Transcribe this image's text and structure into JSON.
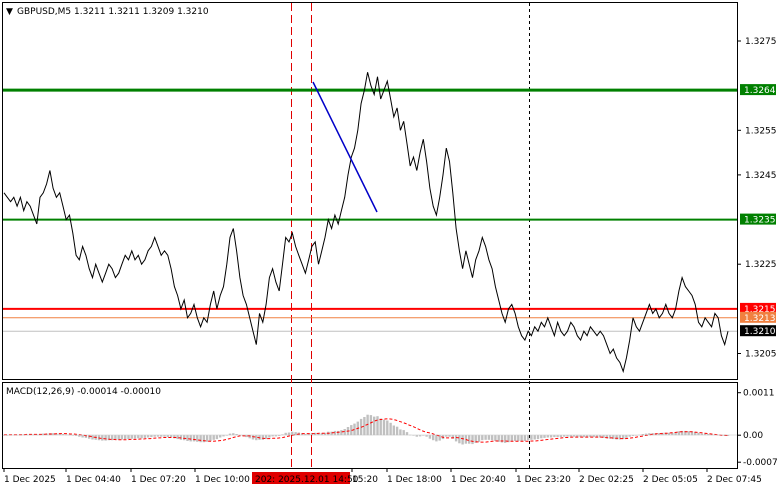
{
  "header": {
    "symbol_line": "GBPUSD,M5  1.3211 1.3211 1.3209 1.3210"
  },
  "price_axis": {
    "ticks": [
      "1.3275",
      "1.3255",
      "1.3245",
      "1.3225",
      "1.3205"
    ],
    "tick_values": [
      1.3275,
      1.3255,
      1.3245,
      1.3225,
      1.3205
    ],
    "range": [
      1.31993,
      1.32835
    ]
  },
  "levels": [
    {
      "name": "upper-green",
      "price": 1.3264,
      "label": "1.3264",
      "color": "#008000"
    },
    {
      "name": "middle-green",
      "price": 1.3235,
      "label": "1.3235",
      "color": "#008000"
    },
    {
      "name": "red",
      "price": 1.3215,
      "label": "1.3215",
      "color": "#ff0000"
    },
    {
      "name": "orange",
      "price": 1.3213,
      "label": "1.3213",
      "color": "#f08040"
    },
    {
      "name": "current",
      "price": 1.321,
      "label": "1.3210",
      "color": "#c0c0c0"
    }
  ],
  "macd": {
    "header": "MACD(12,26,9) -0.00014 -0.00010",
    "ticks": [
      "0.0011",
      "0.00",
      "-0.0007"
    ],
    "tick_values": [
      0.0011,
      0.0,
      -0.0007
    ],
    "range": [
      -0.00085,
      0.00135
    ],
    "histogram_color": "#c0c0c0",
    "signal_color": "#ff0000"
  },
  "time_axis": {
    "labels": [
      "1 Dec 2025",
      "1 Dec 04:40",
      "1 Dec 07:20",
      "1 Dec 10:00",
      "15:20",
      "1 Dec 18:00",
      "1 Dec 20:40",
      "1 Dec 23:20",
      "2 Dec 02:25",
      "2 Dec 05:05",
      "2 Dec 07:45"
    ],
    "highlight_label": "202: 2025.12.01 14:50",
    "highlight_color": "#e00000"
  },
  "colors": {
    "price_line": "#000000",
    "trend_line": "#0000c8",
    "red_dashed": "#e00000",
    "black_dotted": "#000000"
  },
  "chart_data": {
    "type": "line",
    "series": [
      {
        "values": [
          1.3241,
          1.324,
          1.3239,
          1.324,
          1.3238,
          1.324,
          1.3237,
          1.3239,
          1.3238,
          1.3236,
          1.3234,
          1.324,
          1.3241,
          1.3243,
          1.3246,
          1.3242,
          1.324,
          1.3241,
          1.3238,
          1.3235,
          1.3236,
          1.3232,
          1.3227,
          1.3226,
          1.3229,
          1.3227,
          1.3224,
          1.3222,
          1.3225,
          1.3223,
          1.3221,
          1.3223,
          1.3225,
          1.3224,
          1.3222,
          1.3223,
          1.3225,
          1.3227,
          1.3226,
          1.3228,
          1.3226,
          1.3227,
          1.3225,
          1.3226,
          1.3228,
          1.3229,
          1.3231,
          1.3229,
          1.3227,
          1.3228,
          1.3227,
          1.3224,
          1.322,
          1.3218,
          1.3215,
          1.3217,
          1.3213,
          1.3214,
          1.3216,
          1.3213,
          1.3211,
          1.3213,
          1.3212,
          1.3216,
          1.3219,
          1.3215,
          1.3218,
          1.322,
          1.3225,
          1.3231,
          1.3233,
          1.3228,
          1.3222,
          1.3218,
          1.3216,
          1.3213,
          1.321,
          1.3207,
          1.3214,
          1.3212,
          1.3216,
          1.3222,
          1.3224,
          1.3221,
          1.3219,
          1.3225,
          1.3231,
          1.323,
          1.3232,
          1.3229,
          1.3227,
          1.3225,
          1.3223,
          1.3226,
          1.3229,
          1.323,
          1.3225,
          1.3228,
          1.3231,
          1.3235,
          1.3233,
          1.3236,
          1.3234,
          1.3237,
          1.324,
          1.3245,
          1.3249,
          1.3251,
          1.3255,
          1.3261,
          1.3264,
          1.3268,
          1.3265,
          1.3263,
          1.3267,
          1.3262,
          1.3264,
          1.3266,
          1.3262,
          1.3258,
          1.326,
          1.3255,
          1.3257,
          1.3252,
          1.3247,
          1.3249,
          1.3246,
          1.325,
          1.3253,
          1.3248,
          1.3242,
          1.3238,
          1.3236,
          1.324,
          1.3245,
          1.3251,
          1.3248,
          1.3241,
          1.3233,
          1.3228,
          1.3224,
          1.3228,
          1.3225,
          1.3222,
          1.3226,
          1.3228,
          1.3231,
          1.3229,
          1.3226,
          1.3224,
          1.322,
          1.3217,
          1.3214,
          1.3212,
          1.3215,
          1.3216,
          1.3214,
          1.3211,
          1.3209,
          1.3208,
          1.321,
          1.3209,
          1.3211,
          1.321,
          1.3212,
          1.3211,
          1.3213,
          1.3211,
          1.3209,
          1.3212,
          1.321,
          1.3209,
          1.321,
          1.3212,
          1.3211,
          1.3209,
          1.3208,
          1.321,
          1.3209,
          1.3211,
          1.321,
          1.3209,
          1.321,
          1.3209,
          1.3207,
          1.3205,
          1.3206,
          1.3204,
          1.3203,
          1.3201,
          1.3204,
          1.3208,
          1.3213,
          1.3211,
          1.321,
          1.3212,
          1.3214,
          1.3216,
          1.3214,
          1.3215,
          1.3213,
          1.3214,
          1.3216,
          1.3214,
          1.3213,
          1.3215,
          1.3219,
          1.3222,
          1.322,
          1.3219,
          1.3218,
          1.3216,
          1.3212,
          1.3211,
          1.3213,
          1.3212,
          1.3211,
          1.3214,
          1.3213,
          1.3209,
          1.3207,
          1.321
        ]
      }
    ],
    "macd_histogram": [
      0.0,
      0.0,
      1e-05,
      1e-05,
      1e-05,
      2e-05,
      2e-05,
      2e-05,
      2e-05,
      2e-05,
      2e-05,
      3e-05,
      4e-05,
      4e-05,
      5e-05,
      5e-05,
      4e-05,
      4e-05,
      3e-05,
      2e-05,
      1e-05,
      0.0,
      -2e-05,
      -4e-05,
      -6e-05,
      -7e-05,
      -9e-05,
      -0.00011,
      -0.00012,
      -0.00013,
      -0.00014,
      -0.00014,
      -0.00013,
      -0.00013,
      -0.00012,
      -0.00012,
      -0.00011,
      -0.0001,
      -0.0001,
      -9e-05,
      -9e-05,
      -8e-05,
      -8e-05,
      -7e-05,
      -6e-05,
      -5e-05,
      -4e-05,
      -4e-05,
      -4e-05,
      -4e-05,
      -5e-05,
      -6e-05,
      -8e-05,
      -0.0001,
      -0.00012,
      -0.00013,
      -0.00015,
      -0.00016,
      -0.00016,
      -0.00017,
      -0.00018,
      -0.00018,
      -0.00017,
      -0.00015,
      -0.00012,
      -0.0001,
      -6e-05,
      -3e-05,
      0.0,
      4e-05,
      5e-05,
      3e-05,
      0.0,
      -2e-05,
      -5e-05,
      -8e-05,
      -0.00011,
      -0.00013,
      -0.00012,
      -0.00012,
      -0.0001,
      -6e-05,
      -3e-05,
      -3e-05,
      -2e-05,
      2e-05,
      6e-05,
      7e-05,
      9e-05,
      8e-05,
      7e-05,
      5e-05,
      3e-05,
      4e-05,
      5e-05,
      6e-05,
      4e-05,
      5e-05,
      6e-05,
      9e-05,
      9e-05,
      0.00011,
      0.00011,
      0.00013,
      0.00016,
      0.00021,
      0.00026,
      0.0003,
      0.00035,
      0.00042,
      0.00047,
      0.00053,
      0.00052,
      0.00048,
      0.00049,
      0.00043,
      0.0004,
      0.00038,
      0.00032,
      0.00025,
      0.00022,
      0.00015,
      0.00013,
      8e-05,
      1e-05,
      -1e-05,
      -4e-05,
      -3e-05,
      -1e-05,
      -4e-05,
      -9e-05,
      -0.00013,
      -0.00016,
      -0.00014,
      -0.0001,
      -4e-05,
      -4e-05,
      -9e-05,
      -0.00016,
      -0.00021,
      -0.00024,
      -0.00022,
      -0.00022,
      -0.00023,
      -0.0002,
      -0.00017,
      -0.00013,
      -0.00012,
      -0.00012,
      -0.00013,
      -0.00015,
      -0.00017,
      -0.00019,
      -0.0002,
      -0.00018,
      -0.00016,
      -0.00015,
      -0.00015,
      -0.00015,
      -0.00015,
      -0.00013,
      -0.00012,
      -0.00011,
      -0.0001,
      -8e-05,
      -7e-05,
      -6e-05,
      -6e-05,
      -5e-05,
      -5e-05,
      -5e-05,
      -4e-05,
      -4e-05,
      -4e-05,
      -4e-05,
      -5e-05,
      -5e-05,
      -5e-05,
      -5e-05,
      -5e-05,
      -5e-05,
      -5e-05,
      -6e-05,
      -7e-05,
      -8e-05,
      -9e-05,
      -0.0001,
      -0.00011,
      -0.00011,
      -0.0001,
      -7e-05,
      -4e-05,
      -2e-05,
      -1e-05,
      1e-05,
      3e-05,
      4e-05,
      5e-05,
      5e-05,
      5e-05,
      5e-05,
      6e-05,
      6e-05,
      6e-05,
      6e-05,
      8e-05,
      0.0001,
      0.00011,
      0.00011,
      0.0001,
      0.0001,
      8e-05,
      6e-05,
      4e-05,
      4e-05,
      3e-05,
      2e-05,
      2e-05,
      1e-05,
      -1e-05,
      -2e-05,
      -2e-05
    ],
    "macd_signal": [
      1e-05,
      1e-05,
      1e-05,
      1e-05,
      1e-05,
      1e-05,
      1e-05,
      2e-05,
      2e-05,
      2e-05,
      2e-05,
      2e-05,
      2e-05,
      3e-05,
      3e-05,
      3e-05,
      4e-05,
      4e-05,
      4e-05,
      4e-05,
      3e-05,
      3e-05,
      2e-05,
      1e-05,
      -0.0,
      -2e-05,
      -3e-05,
      -5e-05,
      -6e-05,
      -8e-05,
      -9e-05,
      -0.0001,
      -0.00011,
      -0.00011,
      -0.00012,
      -0.00012,
      -0.00012,
      -0.00012,
      -0.00011,
      -0.00011,
      -0.00011,
      -0.0001,
      -0.0001,
      -9e-05,
      -9e-05,
      -8e-05,
      -7e-05,
      -7e-05,
      -6e-05,
      -6e-05,
      -6e-05,
      -6e-05,
      -6e-05,
      -7e-05,
      -8e-05,
      -9e-05,
      -0.0001,
      -0.00011,
      -0.00012,
      -0.00013,
      -0.00014,
      -0.00015,
      -0.00016,
      -0.00016,
      -0.00015,
      -0.00014,
      -0.00013,
      -0.00011,
      -9e-05,
      -6e-05,
      -4e-05,
      -2e-05,
      -2e-05,
      -2e-05,
      -2e-05,
      -4e-05,
      -5e-05,
      -7e-05,
      -8e-05,
      -9e-05,
      -9e-05,
      -8e-05,
      -8e-05,
      -7e-05,
      -6e-05,
      -4e-05,
      -2e-05,
      -0.0,
      2e-05,
      3e-05,
      4e-05,
      4e-05,
      4e-05,
      4e-05,
      4e-05,
      5e-05,
      5e-05,
      5e-05,
      5e-05,
      6e-05,
      7e-05,
      8e-05,
      9e-05,
      0.0001,
      0.00011,
      0.00013,
      0.00016,
      0.00019,
      0.00022,
      0.00026,
      0.0003,
      0.00034,
      0.00038,
      0.0004,
      0.00041,
      0.00042,
      0.00042,
      0.00041,
      0.00039,
      0.00036,
      0.00033,
      0.0003,
      0.00026,
      0.00023,
      0.00019,
      0.00015,
      0.00011,
      8e-05,
      6e-05,
      4e-05,
      1e-05,
      -2e-05,
      -5e-05,
      -7e-05,
      -7e-05,
      -7e-05,
      -6e-05,
      -7e-05,
      -9e-05,
      -0.00011,
      -0.00014,
      -0.00016,
      -0.00017,
      -0.00018,
      -0.00018,
      -0.00018,
      -0.00017,
      -0.00016,
      -0.00015,
      -0.00015,
      -0.00015,
      -0.00015,
      -0.00016,
      -0.00016,
      -0.00016,
      -0.00016,
      -0.00016,
      -0.00016,
      -0.00016,
      -0.00015,
      -0.00015,
      -0.00014,
      -0.00013,
      -0.00012,
      -0.00011,
      -0.0001,
      -9e-05,
      -8e-05,
      -7e-05,
      -6e-05,
      -6e-05,
      -5e-05,
      -5e-05,
      -5e-05,
      -5e-05,
      -5e-05,
      -5e-05,
      -5e-05,
      -5e-05,
      -5e-05,
      -5e-05,
      -6e-05,
      -7e-05,
      -7e-05,
      -8e-05,
      -8e-05,
      -9e-05,
      -9e-05,
      -8e-05,
      -7e-05,
      -6e-05,
      -4e-05,
      -3e-05,
      -1e-05,
      0.0,
      2e-05,
      3e-05,
      4e-05,
      4e-05,
      5e-05,
      5e-05,
      6e-05,
      7e-05,
      8e-05,
      9e-05,
      9e-05,
      9e-05,
      9e-05,
      8e-05,
      7e-05,
      6e-05,
      5e-05,
      4e-05,
      3e-05,
      2e-05,
      1e-05,
      0.0,
      -0.0,
      -1e-05
    ]
  }
}
